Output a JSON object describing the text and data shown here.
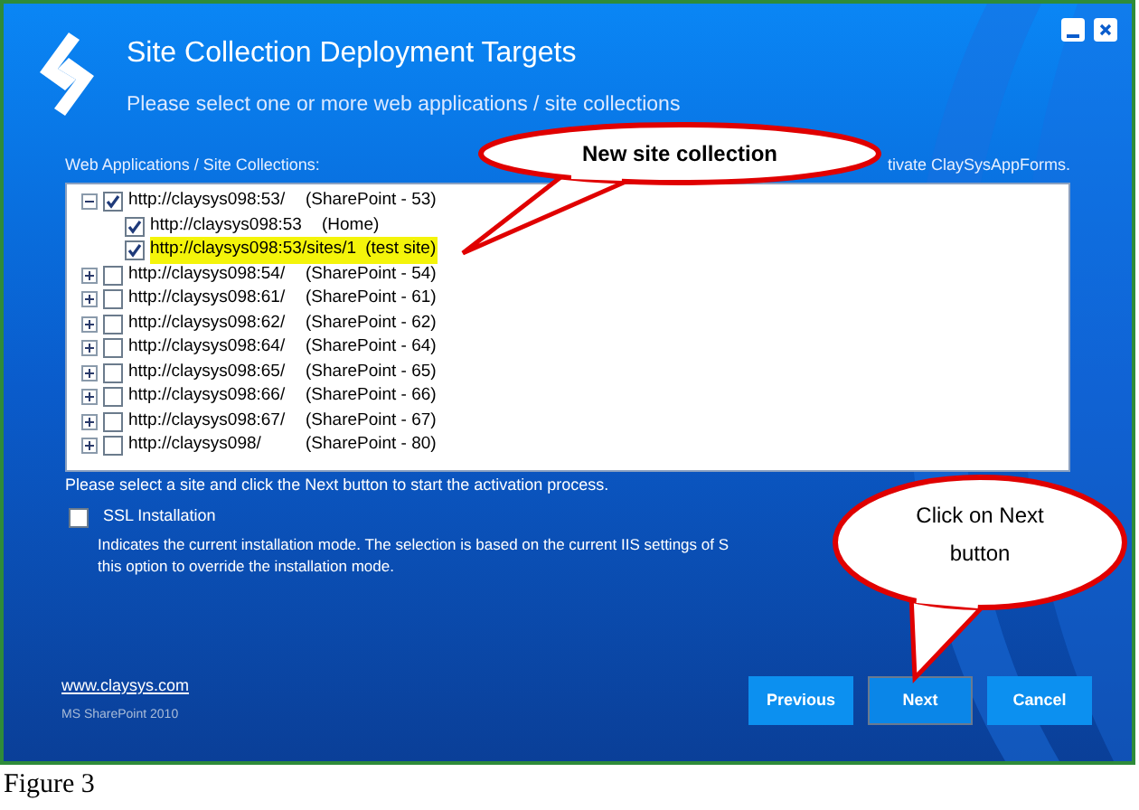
{
  "window": {
    "title": "Site Collection Deployment Targets",
    "subtitle": "Please select one or more web applications / site collections"
  },
  "list_label": "Web Applications / Site Collections:",
  "side_note": "tivate ClaySysAppForms.",
  "tree": [
    {
      "url": "http://claysys098:53/",
      "label": "(SharePoint - 53)",
      "checked": true,
      "expanded": true,
      "highlighted": false,
      "children": [
        {
          "url": "http://claysys098:53",
          "label": "(Home)",
          "checked": true,
          "highlighted": false
        },
        {
          "url": "http://claysys098:53/sites/1",
          "label": "(test site)",
          "checked": true,
          "highlighted": true
        }
      ]
    },
    {
      "url": "http://claysys098:54/",
      "label": "(SharePoint - 54)",
      "checked": false,
      "expanded": false,
      "highlighted": false
    },
    {
      "url": "http://claysys098:61/",
      "label": "(SharePoint - 61)",
      "checked": false,
      "expanded": false,
      "highlighted": false
    },
    {
      "url": "http://claysys098:62/",
      "label": "(SharePoint - 62)",
      "checked": false,
      "expanded": false,
      "highlighted": false
    },
    {
      "url": "http://claysys098:64/",
      "label": "(SharePoint - 64)",
      "checked": false,
      "expanded": false,
      "highlighted": false
    },
    {
      "url": "http://claysys098:65/",
      "label": "(SharePoint - 65)",
      "checked": false,
      "expanded": false,
      "highlighted": false
    },
    {
      "url": "http://claysys098:66/",
      "label": "(SharePoint - 66)",
      "checked": false,
      "expanded": false,
      "highlighted": false
    },
    {
      "url": "http://claysys098:67/",
      "label": "(SharePoint - 67)",
      "checked": false,
      "expanded": false,
      "highlighted": false
    },
    {
      "url": "http://claysys098/",
      "label": "(SharePoint - 80)",
      "checked": false,
      "expanded": false,
      "highlighted": false
    }
  ],
  "hint": "Please select a site and click the Next button to start the activation process.",
  "ssl": {
    "label": "SSL Installation",
    "checked": false,
    "description": [
      "Indicates the current installation mode. The selection is based on the current IIS settings of S",
      "this option to override the installation mode."
    ]
  },
  "footer": {
    "link": "www.claysys.com",
    "product": "MS SharePoint 2010"
  },
  "buttons": [
    {
      "label": "Previous",
      "selected": false
    },
    {
      "label": "Next",
      "selected": true
    },
    {
      "label": "Cancel",
      "selected": false
    }
  ],
  "callouts": [
    {
      "text": "New site collection"
    },
    {
      "text": "Click on Next button"
    }
  ],
  "caption": "Figure 3"
}
